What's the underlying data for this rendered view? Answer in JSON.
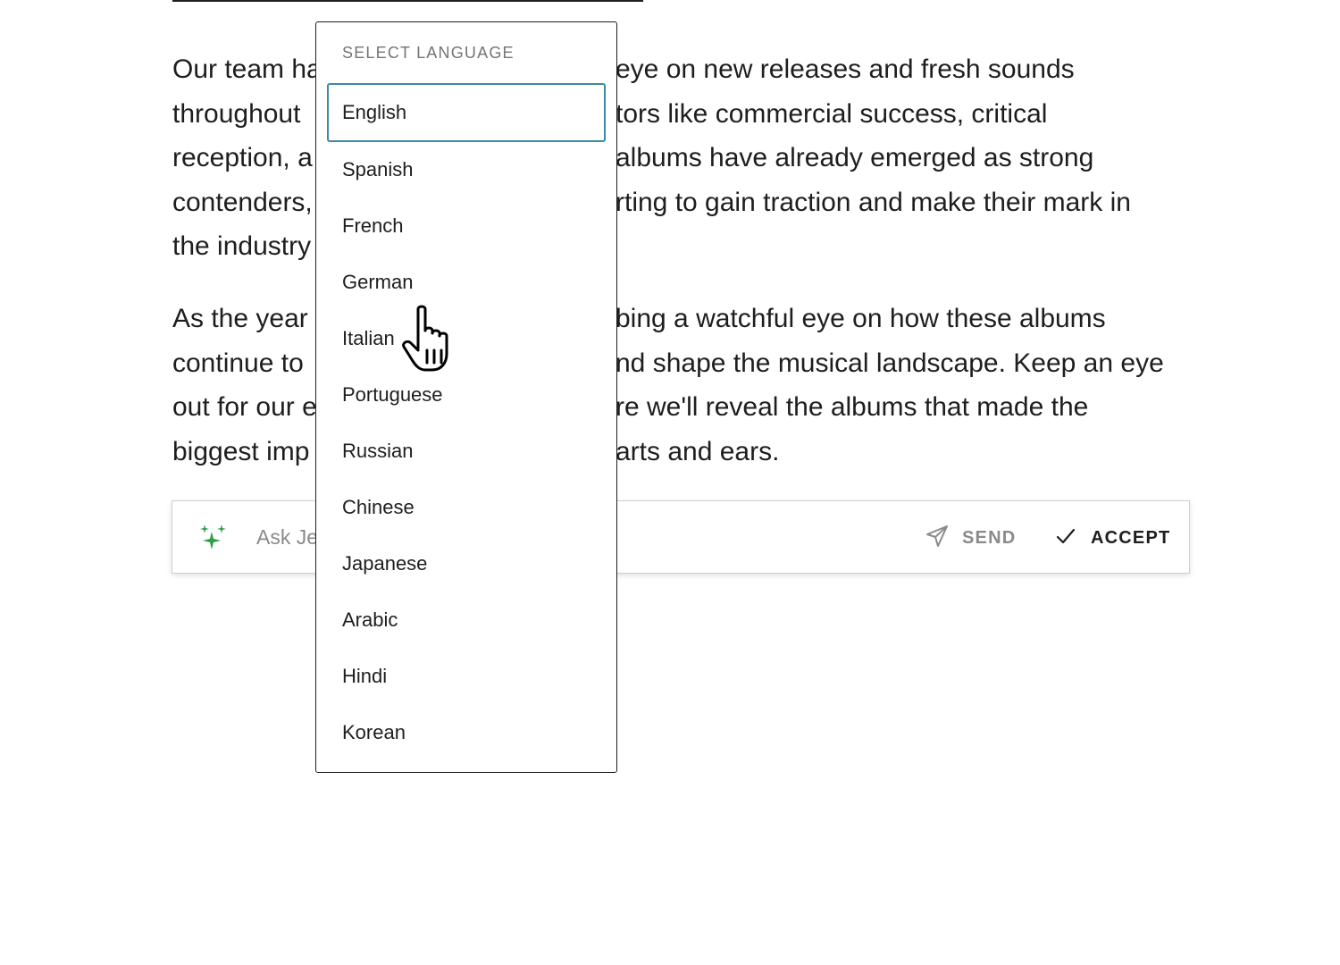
{
  "paragraphs": [
    {
      "left_fragments": [
        "Our team ha",
        "throughout",
        "reception, a",
        "contenders,",
        "the industry"
      ],
      "right_fragments": [
        "eye on new releases and fresh sounds",
        "tors like commercial success, critical",
        "albums have already emerged as strong",
        "rting to gain traction and make their mark in",
        ""
      ]
    },
    {
      "left_fragments": [
        "As the year",
        "continue to",
        "out for our e",
        "biggest imp"
      ],
      "right_fragments": [
        "bing a watchful eye on how these albums",
        "nd shape the musical landscape. Keep an eye",
        "re we'll reveal the albums that made the",
        "arts and ears."
      ]
    }
  ],
  "ask_bar": {
    "placeholder": "Ask Je",
    "send_label": "SEND",
    "accept_label": "ACCEPT",
    "sparkle_color": "#2e9e44"
  },
  "language_dropdown": {
    "heading": "SELECT LANGUAGE",
    "selected": "English",
    "options": [
      "English",
      "Spanish",
      "French",
      "German",
      "Italian",
      "Portuguese",
      "Russian",
      "Chinese",
      "Japanese",
      "Arabic",
      "Hindi",
      "Korean"
    ],
    "focus_color": "#3a89a8"
  },
  "icons": {
    "sparkle": "sparkle-icon",
    "send": "send-icon",
    "accept": "checkmark-icon",
    "cursor": "hand-pointer-icon"
  }
}
